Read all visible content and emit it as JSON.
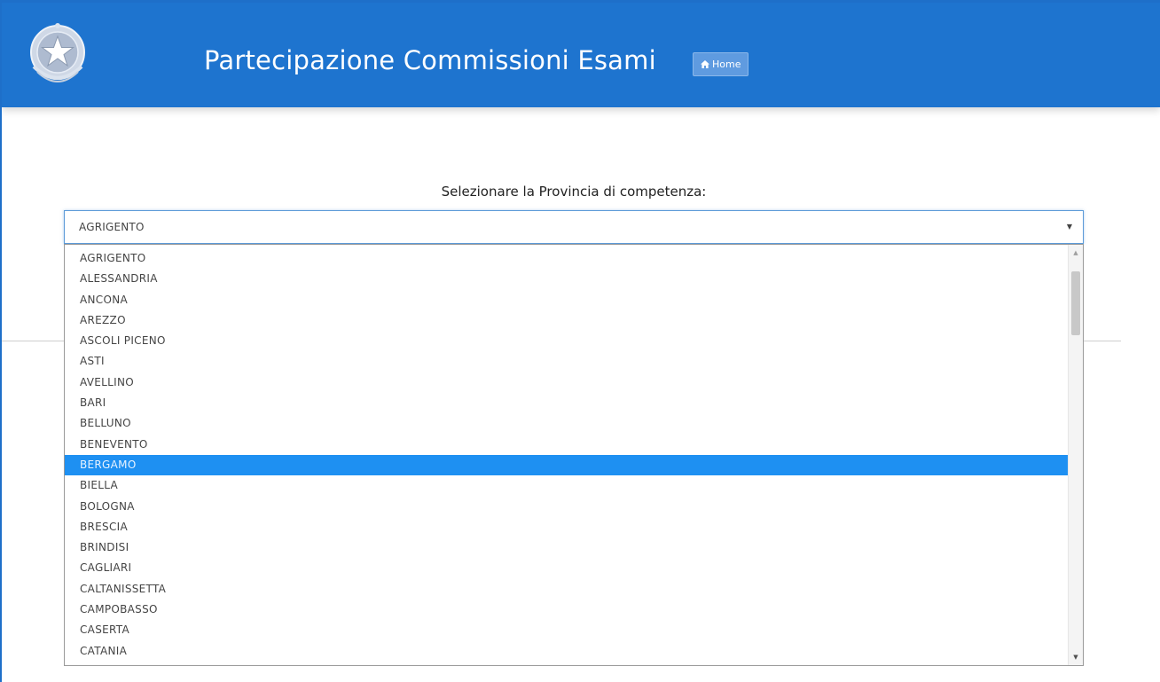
{
  "header": {
    "title": "Partecipazione Commissioni Esami",
    "home_label": "Home",
    "emblem": "italian-republic-emblem",
    "accent_color": "#1e74cf"
  },
  "form": {
    "prompt": "Selezionare la Provincia di competenza:",
    "selected_value": "AGRIGENTO",
    "highlighted_option": "BERGAMO",
    "options": [
      "AGRIGENTO",
      "ALESSANDRIA",
      "ANCONA",
      "AREZZO",
      "ASCOLI PICENO",
      "ASTI",
      "AVELLINO",
      "BARI",
      "BELLUNO",
      "BENEVENTO",
      "BERGAMO",
      "BIELLA",
      "BOLOGNA",
      "BRESCIA",
      "BRINDISI",
      "CAGLIARI",
      "CALTANISSETTA",
      "CAMPOBASSO",
      "CASERTA",
      "CATANIA"
    ],
    "highlight_color": "#1e90f2"
  },
  "icons": {
    "home": "home-icon",
    "caret": "chevron-down-icon",
    "scroll_up": "scroll-up-arrow-icon",
    "scroll_down": "scroll-down-arrow-icon"
  }
}
